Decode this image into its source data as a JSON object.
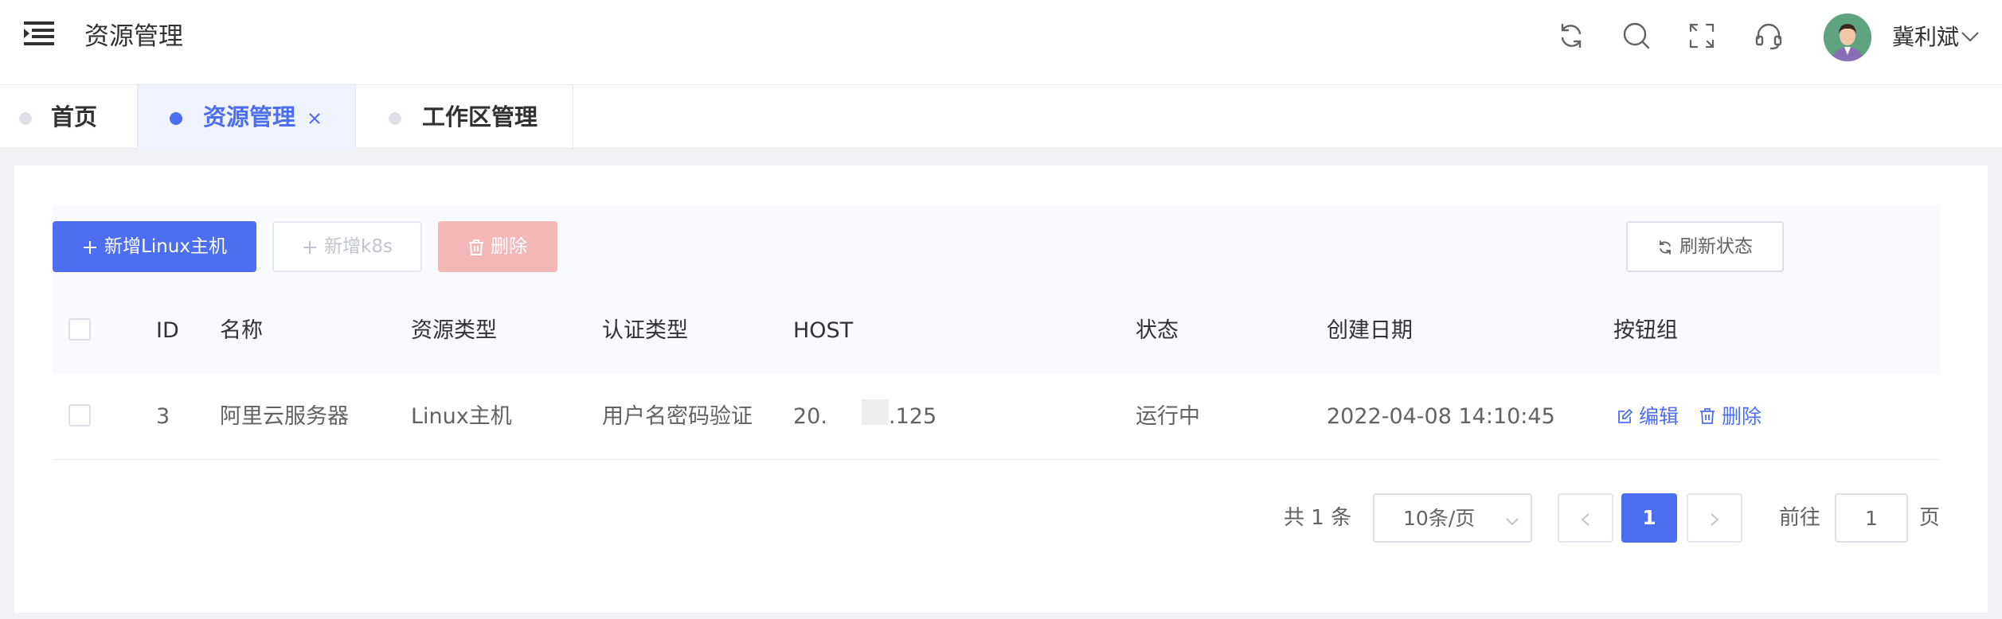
{
  "header": {
    "title": "资源管理",
    "user_name": "冀利斌",
    "icons": [
      "refresh-icon",
      "search-icon",
      "fullscreen-icon",
      "headset-icon"
    ]
  },
  "tabs": [
    {
      "label": "首页",
      "active": false
    },
    {
      "label": "资源管理",
      "active": true
    },
    {
      "label": "工作区管理",
      "active": false
    }
  ],
  "toolbar": {
    "add_linux_label": "新增Linux主机",
    "add_k8s_label": "新增k8s",
    "delete_label": "删除",
    "refresh_label": "刷新状态"
  },
  "table": {
    "columns": [
      "ID",
      "名称",
      "资源类型",
      "认证类型",
      "HOST",
      "状态",
      "创建日期",
      "按钮组"
    ],
    "rows": [
      {
        "id": "3",
        "name": "阿里云服务器",
        "type": "Linux主机",
        "auth": "用户名密码验证",
        "host_prefix": "20.",
        "host_suffix": ".125",
        "status": "运行中",
        "created": "2022-04-08 14:10:45",
        "edit_label": "编辑",
        "delete_label": "删除"
      }
    ]
  },
  "pagination": {
    "total_text": "共 1 条",
    "page_size": "10条/页",
    "current_page": "1",
    "goto_label": "前往",
    "goto_value": "1",
    "page_suffix": "页"
  },
  "colors": {
    "primary": "#4e6ef2",
    "danger_light": "#f3b7b8",
    "text": "#303133"
  }
}
